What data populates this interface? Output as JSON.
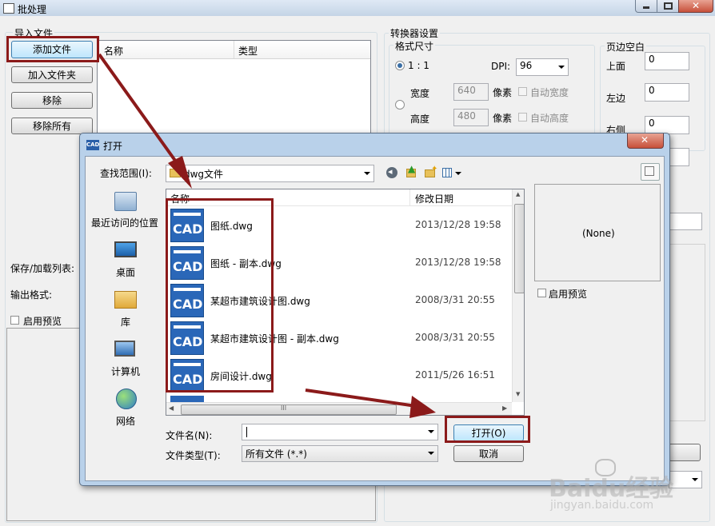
{
  "main_window": {
    "title": "批处理",
    "import_group_label": "导入文件",
    "buttons": {
      "add_file": "添加文件",
      "add_folder": "加入文件夹",
      "remove": "移除",
      "remove_all": "移除所有"
    },
    "file_list_headers": [
      "名称",
      "类型"
    ],
    "save_load_label": "保存/加载列表:",
    "output_format_label": "输出格式:",
    "enable_preview_label": "启用预览",
    "converter_settings_label": "转换器设置",
    "format_size_label": "格式尺寸",
    "ratio_label": "1 : 1",
    "dpi_label": "DPI:",
    "dpi_value": "96",
    "width_label": "宽度",
    "width_value": "640",
    "height_label": "高度",
    "height_value": "480",
    "pixel_label": "像素",
    "auto_width_label": "自动宽度",
    "auto_height_label": "自动高度",
    "margin_group_label": "页边空白",
    "margin_top_label": "上面",
    "margin_top_value": "0",
    "margin_left_label": "左边",
    "margin_left_value": "0",
    "margin_right_label": "右侧",
    "margin_right_value": "0"
  },
  "open_dialog": {
    "title": "打开",
    "app_badge": "CAD",
    "look_in_label": "查找范围(I):",
    "look_in_value": "dwg文件",
    "places": [
      {
        "label": "最近访问的位置",
        "icon": "recent-places-icon"
      },
      {
        "label": "桌面",
        "icon": "desktop-icon"
      },
      {
        "label": "库",
        "icon": "library-icon"
      },
      {
        "label": "计算机",
        "icon": "computer-icon"
      },
      {
        "label": "网络",
        "icon": "network-icon"
      }
    ],
    "columns": {
      "name": "名称",
      "modified": "修改日期"
    },
    "files": [
      {
        "name": "图纸.dwg",
        "modified": "2013/12/28 19:58"
      },
      {
        "name": "图纸 - 副本.dwg",
        "modified": "2013/12/28 19:58"
      },
      {
        "name": "某超市建筑设计图.dwg",
        "modified": "2008/3/31 20:55"
      },
      {
        "name": "某超市建筑设计图 - 副本.dwg",
        "modified": "2008/3/31 20:55"
      },
      {
        "name": "房间设计.dwg",
        "modified": "2011/5/26 16:51"
      }
    ],
    "cad_icon_text": "CAD",
    "preview_text": "(None)",
    "enable_preview_label": "启用预览",
    "filename_label": "文件名(N):",
    "filename_value": "",
    "filetype_label": "文件类型(T):",
    "filetype_value": "所有文件 (*.*)",
    "open_button": "打开(O)",
    "cancel_button": "取消",
    "hscroll_grip": "III"
  },
  "watermark": {
    "brand": "Baidu经验",
    "url": "jingyan.baidu.com"
  },
  "colors": {
    "annotation": "#8b1a1a",
    "selection_blue": "#3399ff",
    "titlebar": "#c9dcf0"
  }
}
